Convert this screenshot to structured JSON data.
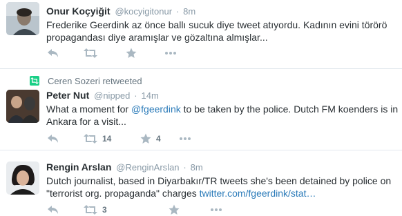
{
  "tweets": [
    {
      "fullname": "Onur Koçyiğit",
      "username": "@kocyigitonur",
      "separator": "·",
      "time": "8m",
      "text": "Frederike Geerdink az önce ballı sucuk diye tweet atıyordu. Kadının evini törörö propagandası diye aramışlar ve gözaltına almışlar...",
      "retweets": "",
      "favorites": ""
    },
    {
      "retweeted_by": "Ceren Sozeri retweeted",
      "fullname": "Peter Nut",
      "username": "@nipped",
      "separator": "·",
      "time": "14m",
      "text_before": "What a moment for ",
      "mention": "@fgeerdink",
      "text_after": " to be taken by the police. Dutch FM koenders is in Ankara for a visit...",
      "retweets": "14",
      "favorites": "4"
    },
    {
      "fullname": "Rengin Arslan",
      "username": "@RenginArslan",
      "separator": "·",
      "time": "8m",
      "text_before": "Dutch journalist, based in Diyarbakır/TR tweets she's been detained by police on \"terrorist org. propaganda\" charges ",
      "link": "twitter.com/fgeerdink/stat…",
      "retweets": "3",
      "favorites": ""
    }
  ],
  "icons": {
    "reply": "reply-icon",
    "retweet": "retweet-icon",
    "favorite": "star-icon",
    "more": "more-icon"
  },
  "colors": {
    "text": "#292f33",
    "muted": "#8899a6",
    "icon": "#aab8c2",
    "link": "#2b7bb9",
    "retweet_green": "#19cf86"
  }
}
